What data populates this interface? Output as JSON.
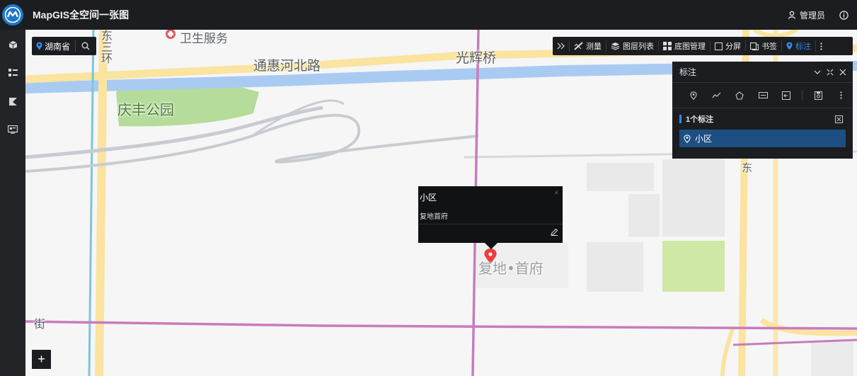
{
  "header": {
    "title": "MapGIS全空间一张图",
    "user": "管理员"
  },
  "region": {
    "name": "湖南省"
  },
  "toolbar": {
    "measure": "测量",
    "layers": "图层列表",
    "basemap": "底图管理",
    "split": "分屏",
    "bookmark": "书签",
    "mark": "标注"
  },
  "panel": {
    "title": "标注",
    "count": "1个标注",
    "item": "小区"
  },
  "popup": {
    "title": "小区",
    "body": "复地首府",
    "close": "×"
  },
  "map": {
    "labels": {
      "health": "卫生服务",
      "road_tonghui": "通惠河北路",
      "guanghui": "光辉桥",
      "park": "庆丰公园",
      "fudi": "复地•首府",
      "ring_east": "东三环",
      "street": "街",
      "east": "东"
    }
  },
  "zoom": {
    "in": "+"
  },
  "colors": {
    "accent": "#2d8cf0",
    "road_pink": "#c97bbd",
    "road_yellow": "#fbe3a0",
    "river": "#a9cbf2",
    "park": "#b5dc9a"
  }
}
